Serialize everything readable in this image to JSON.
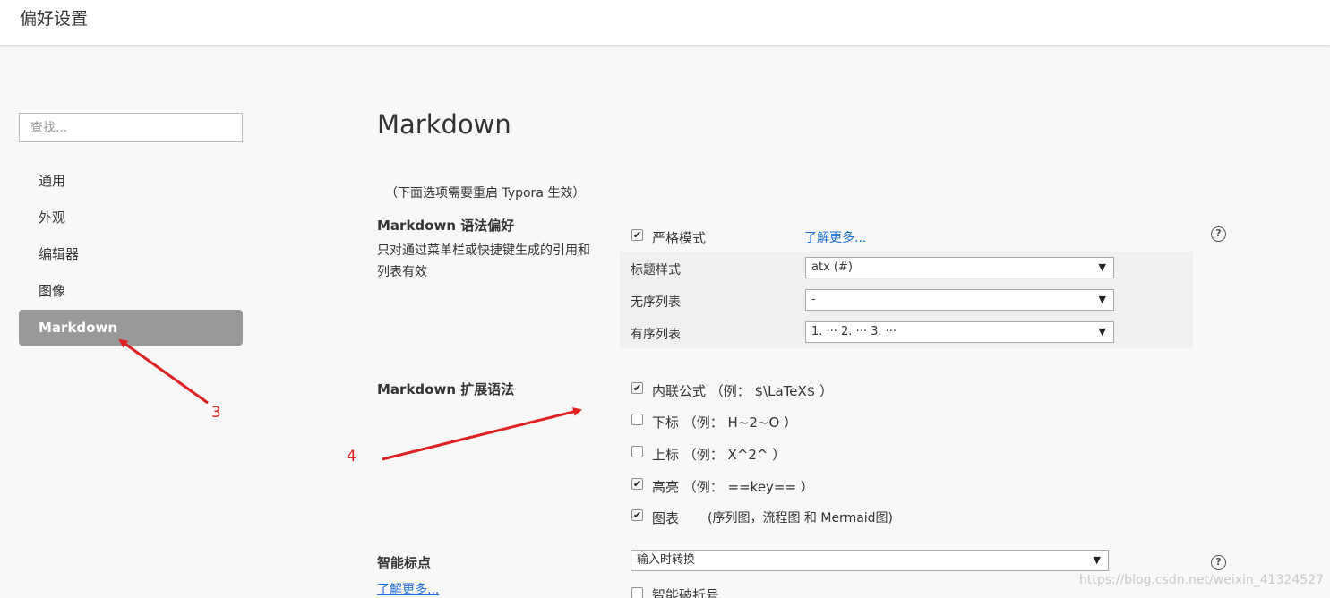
{
  "window": {
    "title": "偏好设置"
  },
  "sidebar": {
    "search_placeholder": "查找...",
    "items": [
      {
        "label": "通用"
      },
      {
        "label": "外观"
      },
      {
        "label": "编辑器"
      },
      {
        "label": "图像"
      },
      {
        "label": "Markdown"
      }
    ]
  },
  "main": {
    "heading": "Markdown",
    "restart_note": "（下面选项需要重启 Typora 生效）",
    "syntax_pref": {
      "title": "Markdown 语法偏好",
      "desc": "只对通过菜单栏或快捷键生成的引用和列表有效",
      "strict_mode_label": "严格模式",
      "strict_mode_checked": true,
      "learn_more": "了解更多...",
      "heading_style_label": "标题样式",
      "heading_style_value": "atx (#)",
      "unordered_label": "无序列表",
      "unordered_value": "-",
      "ordered_label": "有序列表",
      "ordered_value": "1. ··· 2. ··· 3. ···"
    },
    "extended": {
      "title": "Markdown 扩展语法",
      "options": [
        {
          "label": "内联公式 （例： $\\LaTeX$ ）",
          "checked": true
        },
        {
          "label": "下标 （例： H~2~O ）",
          "checked": false
        },
        {
          "label": "上标 （例： X^2^ ）",
          "checked": false
        },
        {
          "label": "高亮 （例： ==key== ）",
          "checked": true
        },
        {
          "label": "图表",
          "checked": true
        }
      ],
      "diagram_note": "(序列图，流程图 和 Mermaid图)"
    },
    "smart_punct": {
      "title": "智能标点",
      "learn_more": "了解更多...",
      "select_value": "输入时转换",
      "dash_label": "智能破折号"
    }
  },
  "annotations": {
    "arrow3_label": "3",
    "arrow4_label": "4"
  },
  "watermark": "https://blog.csdn.net/weixin_41324527",
  "colors": {
    "active_nav_bg": "#999999",
    "link": "#1e6fd9",
    "annotation": "#e02020"
  }
}
